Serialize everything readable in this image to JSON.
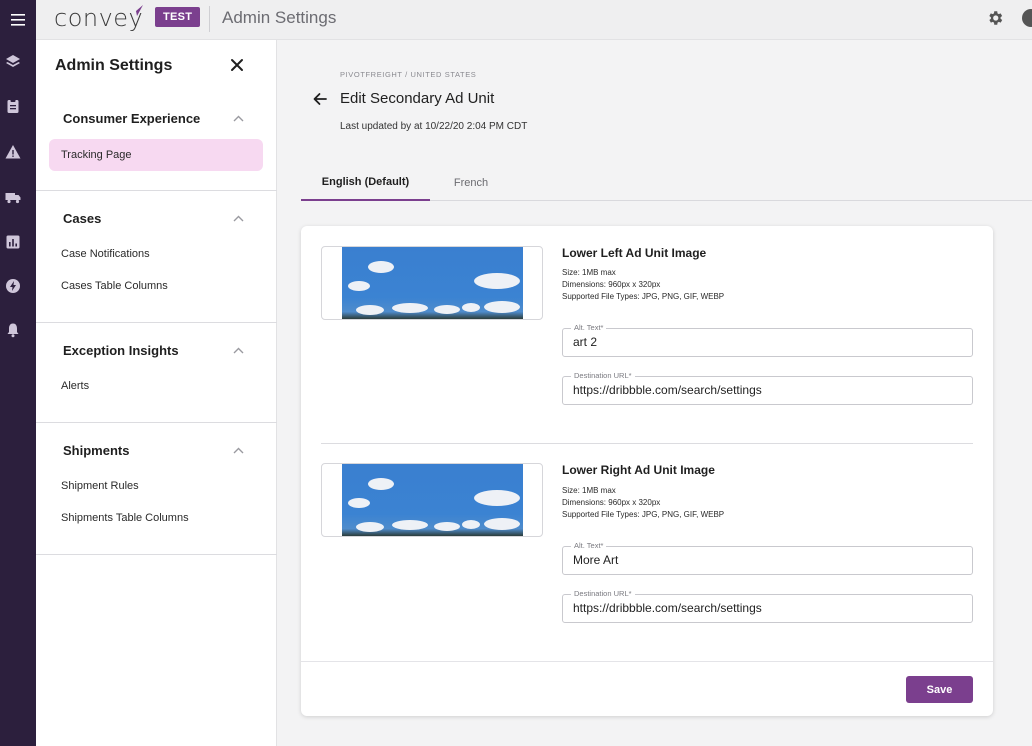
{
  "topbar": {
    "logo": "convey",
    "env_badge": "TEST",
    "title": "Admin Settings",
    "icons": [
      "menu-icon",
      "gear-icon",
      "help-icon"
    ]
  },
  "rail": {
    "icons": [
      "layers-icon",
      "clipboard-icon",
      "warning-icon",
      "truck-icon",
      "bar-chart-icon",
      "bolt-icon",
      "bell-icon"
    ]
  },
  "panel": {
    "title": "Admin Settings",
    "sections": [
      {
        "heading": "Consumer Experience",
        "items": [
          "Tracking Page"
        ]
      },
      {
        "heading": "Cases",
        "items": [
          "Case Notifications",
          "Cases Table Columns"
        ]
      },
      {
        "heading": "Exception Insights",
        "items": [
          "Alerts"
        ]
      },
      {
        "heading": "Shipments",
        "items": [
          "Shipment Rules",
          "Shipments Table Columns"
        ]
      }
    ],
    "active_item": "Tracking Page"
  },
  "main": {
    "breadcrumb": "PIVOTFREIGHT / UNITED STATES",
    "title": "Edit Secondary Ad Unit",
    "updated": "Last updated by at 10/22/20 2:04 PM CDT",
    "tabs": [
      "English (Default)",
      "French"
    ],
    "active_tab": "English (Default)"
  },
  "ads": [
    {
      "title": "Lower Left Ad Unit Image",
      "size": "Size: 1MB max",
      "dimensions": "Dimensions: 960px x 320px",
      "file_types": "Supported File Types: JPG, PNG, GIF, WEBP",
      "alt_label": "Alt. Text*",
      "alt_value": "art 2",
      "url_label": "Destination URL*",
      "url_value": "https://dribbble.com/search/settings"
    },
    {
      "title": "Lower Right Ad Unit Image",
      "size": "Size: 1MB max",
      "dimensions": "Dimensions: 960px x 320px",
      "file_types": "Supported File Types: JPG, PNG, GIF, WEBP",
      "alt_label": "Alt. Text*",
      "alt_value": "More Art",
      "url_label": "Destination URL*",
      "url_value": "https://dribbble.com/search/settings"
    }
  ],
  "actions": {
    "save": "Save"
  },
  "colors": {
    "brand": "#7b3f8e",
    "rail": "#2c1f3d",
    "active_nav": "#f7d9f1"
  }
}
